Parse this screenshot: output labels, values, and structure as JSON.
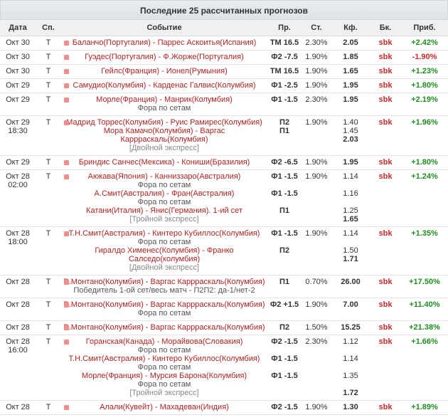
{
  "title": "Последние 25 рассчитанных прогнозов",
  "headers": {
    "date": "Дата",
    "sp": "Сп.",
    "event": "Событие",
    "pr": "Пр.",
    "st": "Ст.",
    "kf": "Кф.",
    "bk": "Бк.",
    "pr2": "Приб."
  },
  "rows": [
    {
      "date": "Окт 30",
      "time": "",
      "sp": "T",
      "lines": [
        {
          "t": "Баланчо(Португалия) - Паррес Аскоитья(Испания)",
          "cls": "ev-line"
        }
      ],
      "pr": [
        "ТМ 16.5"
      ],
      "st": "2.30%",
      "kf": [
        "2.05"
      ],
      "kf_bold_last": true,
      "bk": "sbk",
      "profit": "+2.42%",
      "neg": false
    },
    {
      "date": "Окт 30",
      "time": "",
      "sp": "T",
      "lines": [
        {
          "t": "Гуэдес(Португалия) - Ф.Жорже(Португалия)",
          "cls": "ev-line"
        }
      ],
      "pr": [
        "Ф2 -7.5"
      ],
      "st": "1.90%",
      "kf": [
        "1.85"
      ],
      "kf_bold_last": true,
      "bk": "sbk",
      "profit": "-1.90%",
      "neg": true
    },
    {
      "date": "Окт 30",
      "time": "",
      "sp": "T",
      "lines": [
        {
          "t": "Гейлс(Франция) - Ионел(Румыния)",
          "cls": "ev-line"
        }
      ],
      "pr": [
        "ТМ 16.5"
      ],
      "st": "1.90%",
      "kf": [
        "1.65"
      ],
      "kf_bold_last": true,
      "bk": "sbk",
      "profit": "+1.23%",
      "neg": false
    },
    {
      "date": "Окт 29",
      "time": "",
      "sp": "T",
      "lines": [
        {
          "t": "Самудио(Колумбия) - Карденас Галвис(Колумбия)",
          "cls": "ev-line"
        }
      ],
      "pr": [
        "Ф1 -2.5"
      ],
      "st": "1.90%",
      "kf": [
        "1.95"
      ],
      "kf_bold_last": true,
      "bk": "sbk",
      "profit": "+1.80%",
      "neg": false
    },
    {
      "date": "Окт 29",
      "time": "",
      "sp": "T",
      "lines": [
        {
          "t": "Морле(Франция) - Манрик(Колумбия)",
          "cls": "ev-line"
        },
        {
          "t": "Фора по сетам",
          "cls": "sub"
        }
      ],
      "pr": [
        "Ф1 -1.5"
      ],
      "st": "2.30%",
      "kf": [
        "1.95"
      ],
      "kf_bold_last": true,
      "bk": "sbk",
      "profit": "+2.19%",
      "neg": false
    },
    {
      "date": "Окт 29",
      "time": "18:30",
      "sp": "T",
      "lines": [
        {
          "t": "Мадрид Торрес(Колумбия) - Руис Рамирес(Колумбия)",
          "cls": "ev-line"
        },
        {
          "t": "Мора Камачо(Колумбия) - Варгас",
          "cls": "ev-line"
        },
        {
          "t": "Каррраскаль(Колумбия)",
          "cls": "ev-line"
        },
        {
          "t": "[Двойной экспресс]",
          "cls": "tag"
        }
      ],
      "pr": [
        "П2",
        "П1"
      ],
      "st": "1.90%",
      "kf": [
        "1.40",
        "1.45",
        "2.03"
      ],
      "kf_bold_last": true,
      "bk": "sbk",
      "profit": "+1.96%",
      "neg": false
    },
    {
      "date": "Окт 29",
      "time": "",
      "sp": "T",
      "lines": [
        {
          "t": "Бриндис Санчес(Мексика) - Кониши(Бразилия)",
          "cls": "ev-line"
        }
      ],
      "pr": [
        "Ф2 -6.5"
      ],
      "st": "1.90%",
      "kf": [
        "1.95"
      ],
      "kf_bold_last": true,
      "bk": "sbk",
      "profit": "+1.80%",
      "neg": false
    },
    {
      "date": "Окт 28",
      "time": "02:00",
      "sp": "T",
      "lines": [
        {
          "t": "Аюкава(Япония) - Канниззаро(Австралия)",
          "cls": "ev-line"
        },
        {
          "t": "Фора по сетам",
          "cls": "sub"
        },
        {
          "t": "А.Смит(Австралия) - Фран(Австралия)",
          "cls": "ev-line"
        },
        {
          "t": "Фора по сетам",
          "cls": "sub"
        },
        {
          "t": "Катани(Италия) - Янис(Германия). 1-ий сет",
          "cls": "ev-line"
        },
        {
          "t": "[Тройной экспресс]",
          "cls": "tag"
        }
      ],
      "pr": [
        "Ф1 -1.5",
        "",
        "Ф1 -1.5",
        "",
        "П1"
      ],
      "st": "1.90%",
      "kf": [
        "1.14",
        "",
        "1.16",
        "",
        "1.25",
        "1.65"
      ],
      "kf_bold_last": true,
      "bk": "sbk",
      "profit": "+1.24%",
      "neg": false
    },
    {
      "date": "Окт 28",
      "time": "18:00",
      "sp": "T",
      "lines": [
        {
          "t": "Т.Н.Смит(Австралия) - Кинтеро Кубиллос(Колумбия)",
          "cls": "ev-line"
        },
        {
          "t": "Фора по сетам",
          "cls": "sub"
        },
        {
          "t": "Гиралдо Хименес(Колумбия) - Франко",
          "cls": "ev-line"
        },
        {
          "t": "Салседо(колумбия)",
          "cls": "ev-line"
        },
        {
          "t": "[Двойной экспресс]",
          "cls": "tag"
        }
      ],
      "pr": [
        "Ф1 -1.5",
        "",
        "П2"
      ],
      "st": "1.90%",
      "kf": [
        "1.14",
        "",
        "1.50",
        "1.71"
      ],
      "kf_bold_last": true,
      "bk": "sbk",
      "profit": "+1.35%",
      "neg": false
    },
    {
      "date": "Окт 28",
      "time": "",
      "sp": "T",
      "lines": [
        {
          "t": "В.Монтано(Колумбия) - Варгас Каррраскаль(Колумбия)",
          "cls": "ev-line"
        },
        {
          "t": "Победитель 1-ой сет/весь матч - П2П2: да-1/нет-2",
          "cls": "sub"
        }
      ],
      "pr": [
        "П1"
      ],
      "st": "0.70%",
      "kf": [
        "26.00"
      ],
      "kf_bold_last": true,
      "bk": "sbk",
      "profit": "+17.50%",
      "neg": false
    },
    {
      "date": "Окт 28",
      "time": "",
      "sp": "T",
      "lines": [
        {
          "t": "В.Монтано(Колумбия) - Варгас Каррраскаль(Колумбия)",
          "cls": "ev-line"
        },
        {
          "t": "Фора по сетам",
          "cls": "sub"
        }
      ],
      "pr": [
        "Ф2 +1.5"
      ],
      "st": "1.90%",
      "kf": [
        "7.00"
      ],
      "kf_bold_last": true,
      "bk": "sbk",
      "profit": "+11.40%",
      "neg": false
    },
    {
      "date": "Окт 28",
      "time": "",
      "sp": "T",
      "lines": [
        {
          "t": "В.Монтано(Колумбия) - Варгас Каррраскаль(Колумбия)",
          "cls": "ev-line"
        }
      ],
      "pr": [
        "П2"
      ],
      "st": "1.50%",
      "kf": [
        "15.25"
      ],
      "kf_bold_last": true,
      "bk": "sbk",
      "profit": "+21.38%",
      "neg": false
    },
    {
      "date": "Окт 28",
      "time": "16:00",
      "sp": "T",
      "lines": [
        {
          "t": "Горанская(Канада) - Морайвова(Словакия)",
          "cls": "ev-line"
        },
        {
          "t": "Фора по сетам",
          "cls": "sub"
        },
        {
          "t": "Т.Н.Смит(Австралия) - Кинтеро Кубиллос(Колумбия)",
          "cls": "ev-line"
        },
        {
          "t": "Фора по сетам",
          "cls": "sub"
        },
        {
          "t": "Морле(Франция) - Мурсия Барона(Колумбия)",
          "cls": "ev-line"
        },
        {
          "t": "Фора по сетам",
          "cls": "sub"
        },
        {
          "t": "[Тройной экспресс]",
          "cls": "tag"
        }
      ],
      "pr": [
        "Ф2 -1.5",
        "",
        "Ф1 -1.5",
        "",
        "Ф1 -1.5"
      ],
      "st": "2.30%",
      "kf": [
        "1.12",
        "",
        "1.14",
        "",
        "1.35",
        "",
        "1.72"
      ],
      "kf_bold_last": true,
      "bk": "sbk",
      "profit": "+1.66%",
      "neg": false
    },
    {
      "date": "Окт 28",
      "time": "",
      "sp": "T",
      "lines": [
        {
          "t": "Алали(Кувейт) - Махадеван(Индия)",
          "cls": "ev-line"
        }
      ],
      "pr": [
        "Ф2 -1.5"
      ],
      "st": "1.90%",
      "kf": [
        "1.30"
      ],
      "kf_bold_last": true,
      "bk": "sbk",
      "profit": "+1.89%",
      "neg": false
    }
  ]
}
